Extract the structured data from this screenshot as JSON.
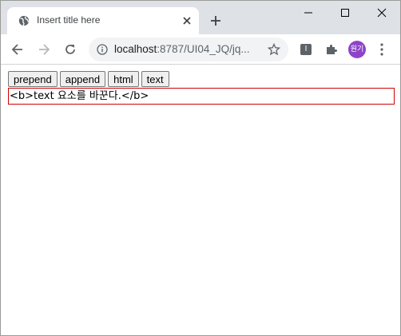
{
  "browser": {
    "tab": {
      "title": "Insert title here",
      "favicon": "globe-icon"
    },
    "address": {
      "host": "localhost",
      "rest": ":8787/UI04_JQ/jq...",
      "security_icon": "info-icon"
    },
    "profile": {
      "initials": "원기",
      "color": "#8e44c8"
    },
    "extension": {
      "label": "I"
    }
  },
  "page": {
    "buttons": [
      {
        "label": "prepend"
      },
      {
        "label": "append"
      },
      {
        "label": "html"
      },
      {
        "label": "text"
      }
    ],
    "target": {
      "text": "<b>text 요소를 바꾼다.</b>",
      "border_color": "#d00000"
    }
  }
}
